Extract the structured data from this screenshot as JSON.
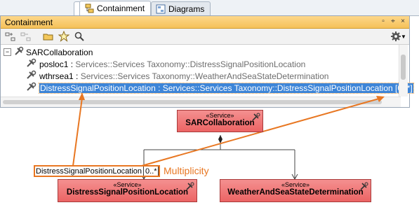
{
  "tabs": [
    {
      "label": "Containment",
      "active": true,
      "icon": "containment-icon"
    },
    {
      "label": "Diagrams",
      "active": false,
      "icon": "diagrams-icon"
    }
  ],
  "panel": {
    "title": "Containment"
  },
  "tree": {
    "root": "SARCollaboration",
    "items": [
      {
        "name": "posloc1",
        "sep": " : ",
        "type": "Services::Services Taxonomy::DistressSignalPositionLocation"
      },
      {
        "name": "wthrsea1",
        "sep": " : ",
        "type": "Services::Services Taxonomy::WeatherAndSeaStateDetermination"
      },
      {
        "selected_text": "DistressSignalPositionLocation : Services::Services Taxonomy::DistressSignalPositionLocation [0..*]"
      }
    ]
  },
  "diagram": {
    "top_class": {
      "stereotype": "«Service»",
      "name": "SARCollaboration"
    },
    "left_class": {
      "stereotype": "«Service»",
      "name": "DistressSignalPositionLocation"
    },
    "right_class": {
      "stereotype": "«Service»",
      "name": "WeatherAndSeaStateDetermination"
    },
    "role_label": "DistressSignalPositionLocation",
    "multiplicity_value": "0..*",
    "callout": "Multiplicity"
  },
  "colors": {
    "accent": "#e87722",
    "selection": "#3d85d8",
    "service_fill": "#ec6464",
    "header": "#f5c15a"
  }
}
